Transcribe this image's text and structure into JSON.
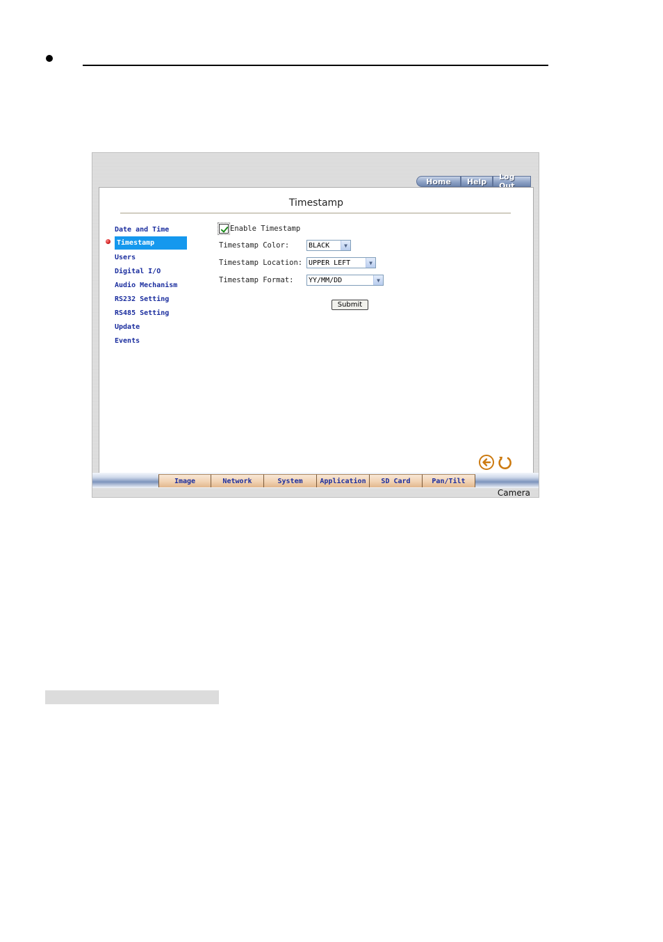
{
  "app": {
    "top_nav": [
      "Home",
      "Help",
      "Log Out"
    ],
    "page_title": "Timestamp",
    "footer_label": "Camera"
  },
  "sidebar": {
    "items": [
      {
        "label": "Date and Time",
        "active": false
      },
      {
        "label": "Timestamp",
        "active": true
      },
      {
        "label": "Users",
        "active": false
      },
      {
        "label": "Digital I/O",
        "active": false
      },
      {
        "label": "Audio Mechanism",
        "active": false
      },
      {
        "label": "RS232 Setting",
        "active": false
      },
      {
        "label": "RS485 Setting",
        "active": false
      },
      {
        "label": "Update",
        "active": false
      },
      {
        "label": "Events",
        "active": false
      }
    ]
  },
  "form": {
    "enable_label": "Enable Timestamp",
    "enable_checked": true,
    "color_label": "Timestamp Color:",
    "color_value": "BLACK",
    "location_label": "Timestamp Location:",
    "location_value": "UPPER LEFT",
    "format_label": "Timestamp Format:",
    "format_value": "YY/MM/DD",
    "submit_label": "Submit"
  },
  "tabs": [
    "Image",
    "Network",
    "System",
    "Application",
    "SD Card",
    "Pan/Tilt"
  ],
  "colors": {
    "active_menu": "#1598ee",
    "menu_text": "#1a2d9e",
    "tab_fill": "#f1d2b3",
    "icon_orange": "#cc7a10"
  }
}
